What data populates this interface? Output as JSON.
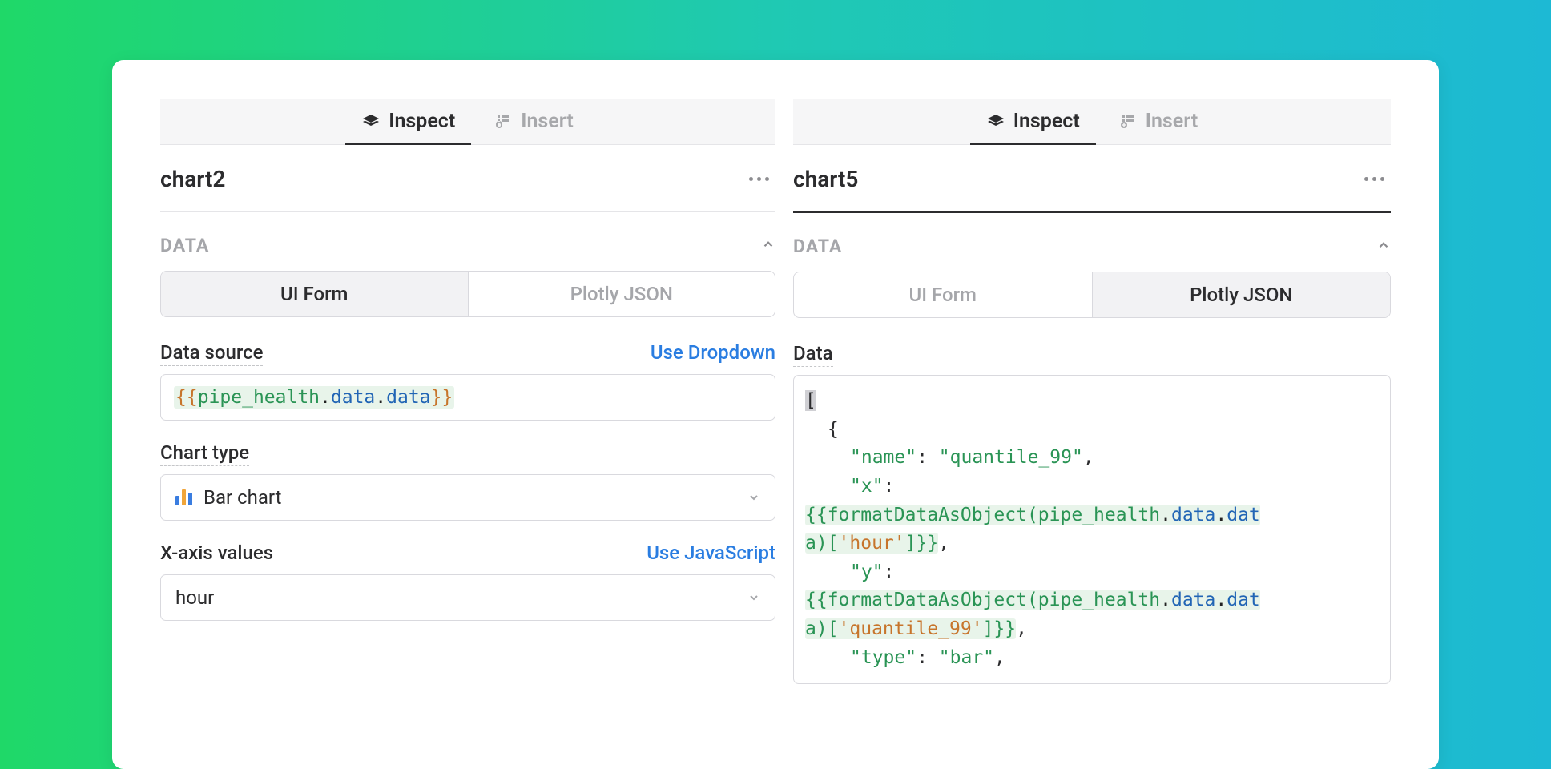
{
  "left": {
    "tabs": {
      "inspect": "Inspect",
      "insert": "Insert"
    },
    "panel_name": "chart2",
    "section_title": "DATA",
    "toggle": {
      "ui_form": "UI Form",
      "plotly_json": "Plotly JSON"
    },
    "fields": {
      "data_source_label": "Data source",
      "data_source_action": "Use Dropdown",
      "chart_type_label": "Chart type",
      "chart_type_value": "Bar chart",
      "xaxis_label": "X-axis values",
      "xaxis_action": "Use JavaScript",
      "xaxis_value": "hour"
    },
    "expr": {
      "open": "{{",
      "id": "pipe_health",
      "p1": "data",
      "p2": "data",
      "close": "}}"
    }
  },
  "right": {
    "tabs": {
      "inspect": "Inspect",
      "insert": "Insert"
    },
    "panel_name": "chart5",
    "section_title": "DATA",
    "toggle": {
      "ui_form": "UI Form",
      "plotly_json": "Plotly JSON"
    },
    "data_label": "Data",
    "code": {
      "line1": "[",
      "line2": "{",
      "line3_key": "\"name\"",
      "line3_val": "\"quantile_99\"",
      "line4_key": "\"x\"",
      "expr1_a": "{{formatDataAsObject(",
      "expr1_b": "pipe_health",
      "expr1_c": "data",
      "expr1_d": "data",
      "expr1_wrap1": "a)[",
      "expr1_lit": "'hour'",
      "expr1_close": "]}}",
      "line6_key": "\"y\"",
      "expr2_wrap1": "a)[",
      "expr2_lit": "'quantile_99'",
      "expr2_close": "]}}",
      "line8_key": "\"type\"",
      "line8_val": "\"bar\""
    }
  }
}
